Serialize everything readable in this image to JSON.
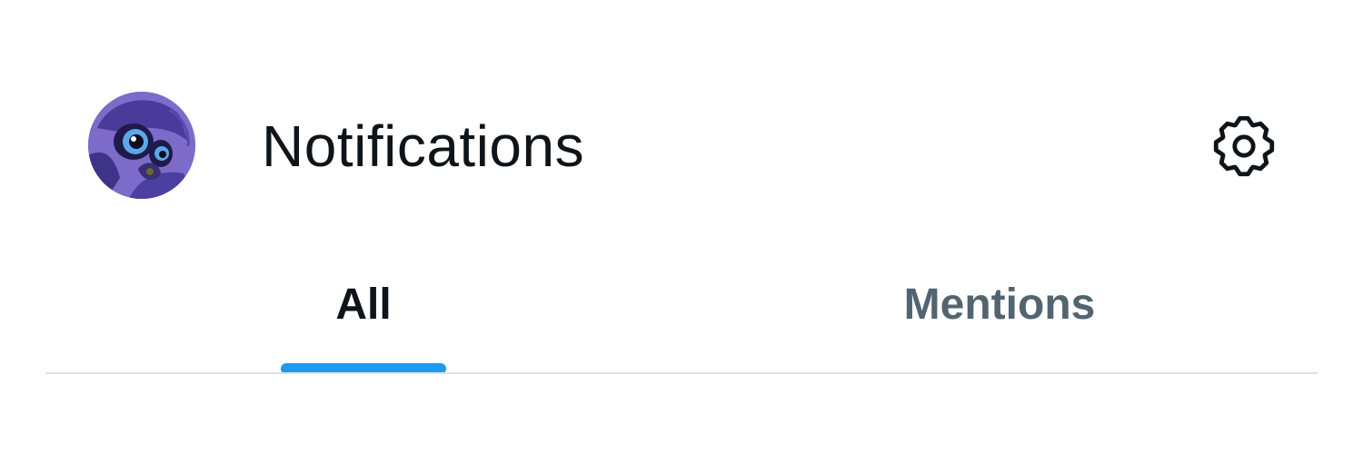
{
  "header": {
    "title": "Notifications",
    "avatar_icon": "cartoon-character-avatar",
    "settings_icon": "gear-icon"
  },
  "tabs": [
    {
      "label": "All",
      "active": true
    },
    {
      "label": "Mentions",
      "active": false
    }
  ],
  "colors": {
    "accent": "#1d9bf0",
    "text_primary": "#0f1419",
    "text_secondary": "#536471",
    "divider": "#dbe3e8",
    "avatar_bg": "#7c6bc9"
  }
}
